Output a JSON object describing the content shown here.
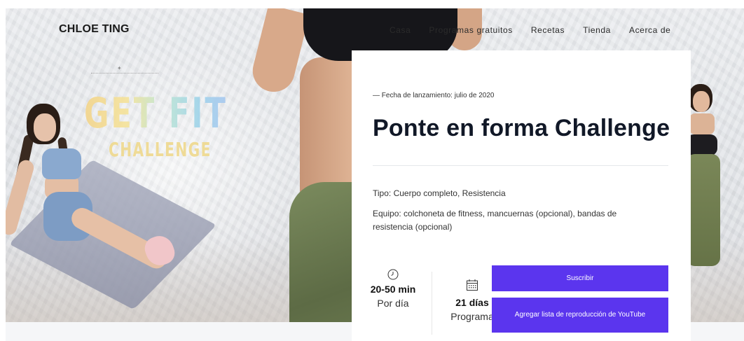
{
  "header": {
    "logo": "CHLOE TING",
    "nav": [
      "Casa",
      "Programas gratuitos",
      "Recetas",
      "Tienda",
      "Acerca de"
    ]
  },
  "hero": {
    "art_title": "GET FIT",
    "art_subtitle": "CHALLENGE"
  },
  "program": {
    "release": "— Fecha de lanzamiento: julio de 2020",
    "title": "Ponte en forma Challenge",
    "type": "Tipo: Cuerpo completo, Resistencia",
    "equipment": "Equipo: colchoneta de fitness, mancuernas (opcional), bandas de resistencia (opcional)",
    "duration_value": "20-50 min",
    "duration_label": "Por día",
    "length_value": "21 días",
    "length_label": "Programa"
  },
  "actions": {
    "subscribe": "Suscribir",
    "youtube_playlist": "Agregar lista de reproducción de YouTube"
  },
  "icons": {
    "duration": "clock-icon",
    "length": "calendar-icon"
  },
  "colors": {
    "accent": "#5b35ee"
  }
}
